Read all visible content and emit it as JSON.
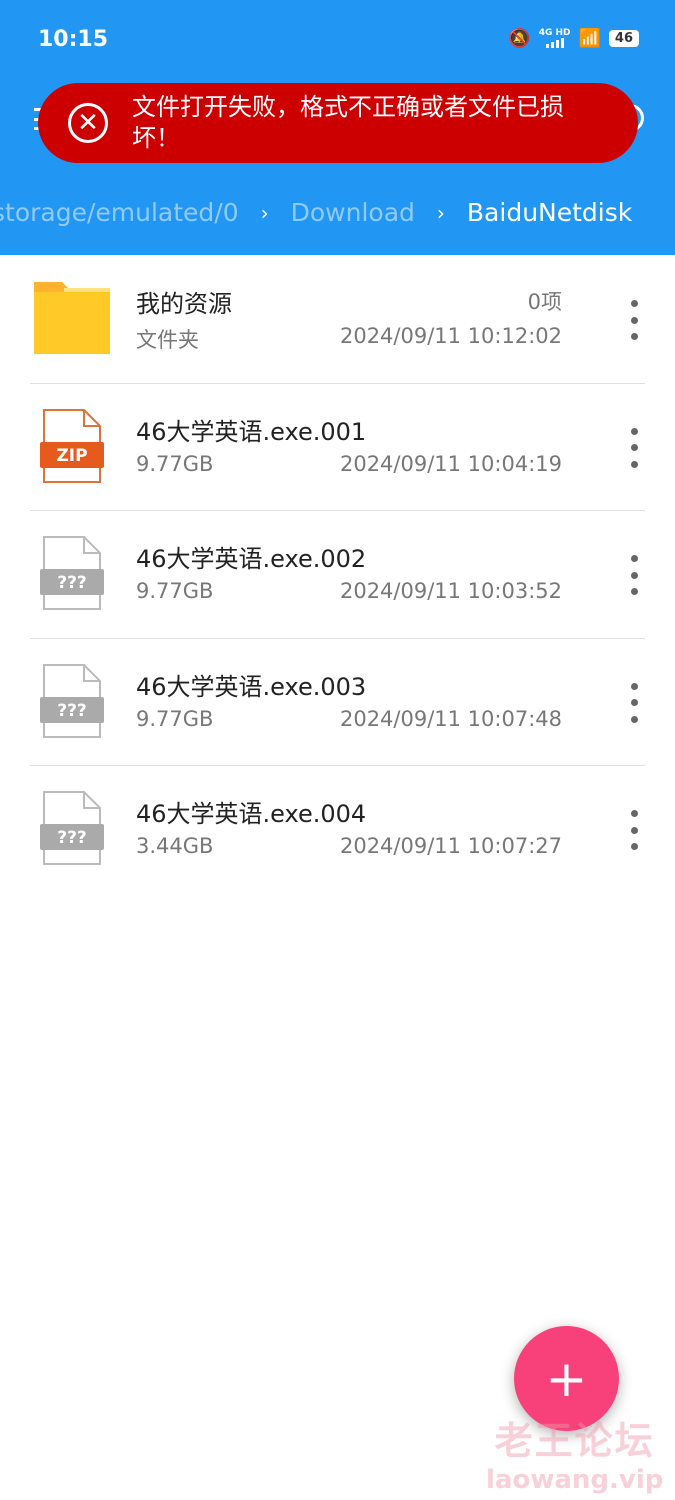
{
  "status_bar": {
    "time": "10:15",
    "network": "4G HD",
    "battery": "46"
  },
  "toast": {
    "message": "文件打开失败，格式不正确或者文件已损坏！",
    "icon": "error-circle-x-icon",
    "color": "#CC0000"
  },
  "breadcrumb": {
    "items": [
      "storage/emulated/0",
      "Download",
      "BaiduNetdisk"
    ]
  },
  "files": [
    {
      "name": "我的资源",
      "type": "folder",
      "sub": "文件夹",
      "count": "0项",
      "date": "2024/09/11 10:12:02"
    },
    {
      "name": "46大学英语.exe.001",
      "type": "zip",
      "sub": "9.77GB",
      "date": "2024/09/11 10:04:19",
      "badge": "ZIP"
    },
    {
      "name": "46大学英语.exe.002",
      "type": "unknown",
      "sub": "9.77GB",
      "date": "2024/09/11 10:03:52",
      "badge": "???"
    },
    {
      "name": "46大学英语.exe.003",
      "type": "unknown",
      "sub": "9.77GB",
      "date": "2024/09/11 10:07:48",
      "badge": "???"
    },
    {
      "name": "46大学英语.exe.004",
      "type": "unknown",
      "sub": "3.44GB",
      "date": "2024/09/11 10:07:27",
      "badge": "???"
    }
  ],
  "fab": {
    "label": "+",
    "color": "#F8417B"
  },
  "watermark": {
    "line1": "老王论坛",
    "line2": "laowang.vip"
  },
  "colors": {
    "header": "#2196F3"
  }
}
